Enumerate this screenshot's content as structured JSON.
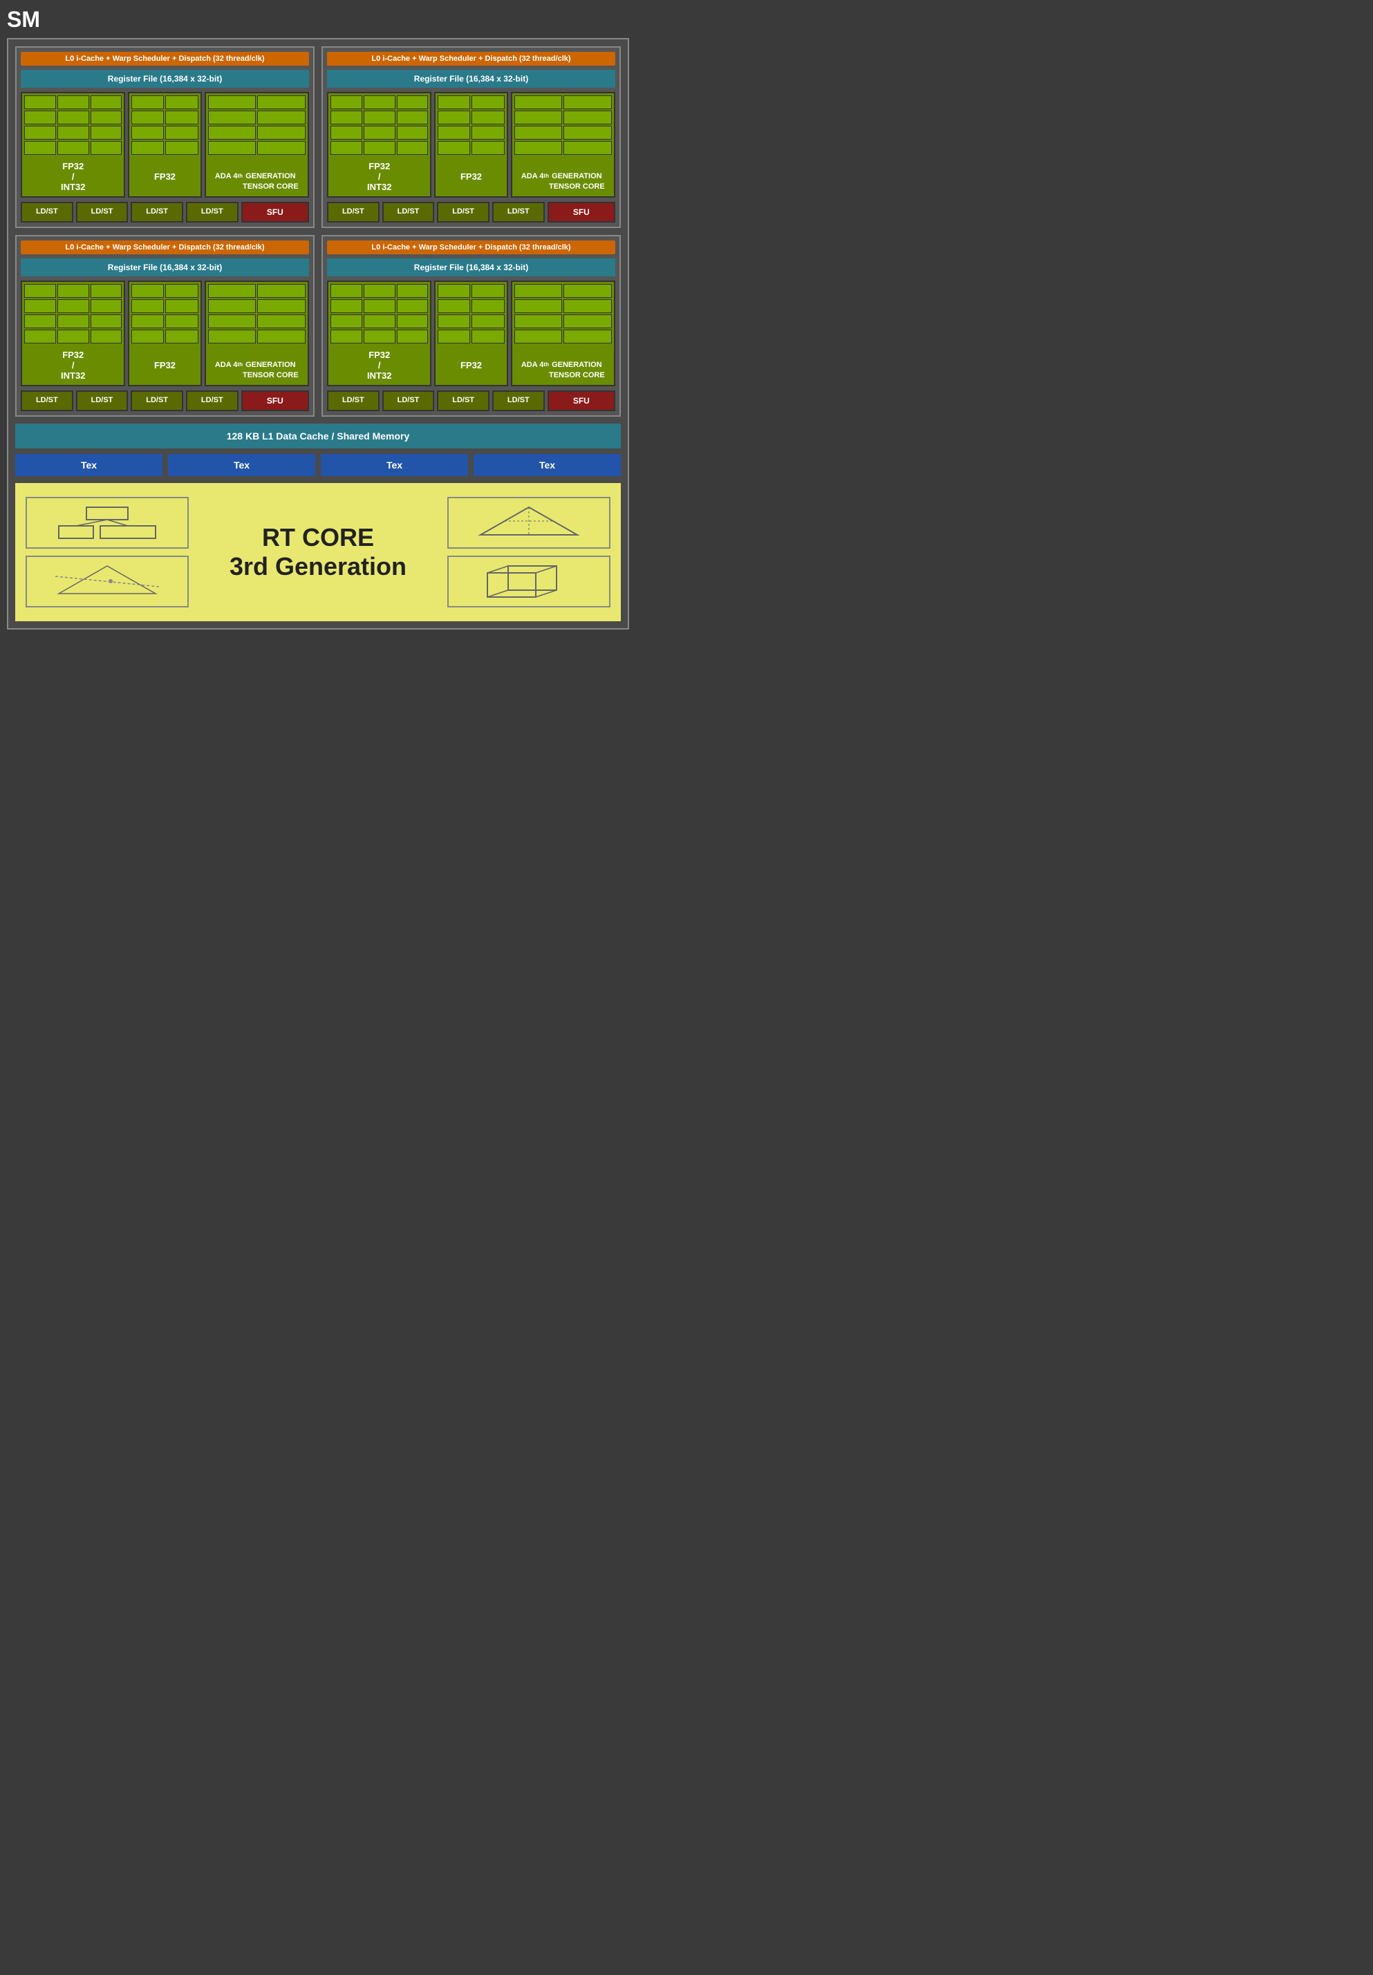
{
  "title": "SM",
  "l0_bar_label": "L0 i-Cache + Warp Scheduler + Dispatch (32 thread/clk)",
  "reg_file_label": "Register File (16,384 x 32-bit)",
  "fp32_int32_label": "FP32 / INT32",
  "fp32_label": "FP32",
  "tensor_label_line1": "ADA 4",
  "tensor_label_line2": "GENERATION",
  "tensor_label_line3": "TENSOR CORE",
  "ldst_label": "LD/ST",
  "sfu_label": "SFU",
  "l1_cache_label": "128 KB L1 Data Cache / Shared Memory",
  "tex_label": "Tex",
  "rt_core_line1": "RT CORE",
  "rt_core_line2": "3rd Generation",
  "colors": {
    "l0_bar": "#cc6600",
    "reg_file": "#2a7a8a",
    "compute": "#6a8c00",
    "sfu": "#8b1a1a",
    "tex": "#2255aa",
    "rt_core_bg": "#e8e870"
  }
}
